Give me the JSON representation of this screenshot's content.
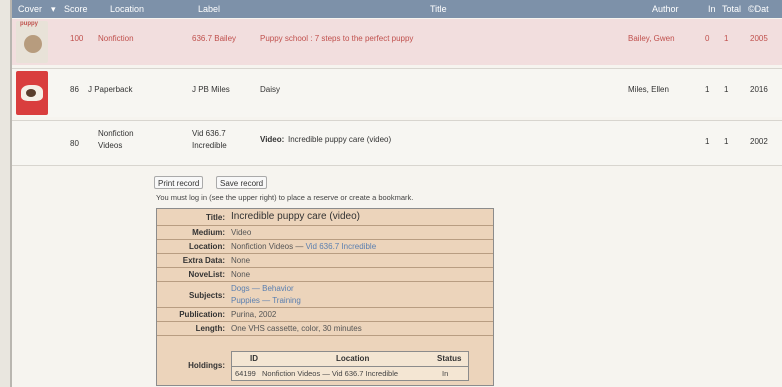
{
  "header": {
    "cover": "Cover",
    "score": "Score",
    "location": "Location",
    "label": "Label",
    "title": "Title",
    "author": "Author",
    "in": "In",
    "total": "Total",
    "date": "©Dat"
  },
  "rows": [
    {
      "cover_text": "puppy",
      "score": "100",
      "location": "Nonfiction",
      "label": "636.7 Bailey",
      "title": "Puppy school : 7 steps to the perfect puppy",
      "author": "Bailey, Gwen",
      "in": "0",
      "total": "1",
      "date": "2005"
    },
    {
      "cover_text": "",
      "score": "86",
      "location": "J Paperback",
      "label": "J PB Miles",
      "title": "Daisy",
      "author": "Miles, Ellen",
      "in": "1",
      "total": "1",
      "date": "2016"
    },
    {
      "cover_text": "",
      "score": "80",
      "location_line1": "Nonfiction",
      "location_line2": "Videos",
      "label_line1": "Vid 636.7",
      "label_line2": "Incredible",
      "title_prefix": "Video:",
      "title": "Incredible puppy care (video)",
      "author": "",
      "in": "1",
      "total": "1",
      "date": "2002"
    }
  ],
  "actions": {
    "print": "Print record",
    "save": "Save record",
    "message": "You must log in (see the upper right) to place a reserve or create a bookmark."
  },
  "detail": {
    "title_label": "Title:",
    "title": "Incredible puppy care (video)",
    "medium_label": "Medium:",
    "medium": "Video",
    "location_label": "Location:",
    "location_text": "Nonfiction Videos —",
    "location_link": "Vid 636.7 Incredible",
    "extra_label": "Extra Data:",
    "extra": "None",
    "novelist_label": "NoveList:",
    "novelist": "None",
    "subjects_label": "Subjects:",
    "subject1": "Dogs — Behavior",
    "subject2": "Puppies — Training",
    "publication_label": "Publication:",
    "publication": "Purina, 2002",
    "length_label": "Length:",
    "length": "One VHS cassette, color, 30 minutes",
    "holdings_label": "Holdings:",
    "holdings": {
      "headers": {
        "id": "ID",
        "location": "Location",
        "status": "Status"
      },
      "row": {
        "id": "64199",
        "location": "Nonfiction Videos — Vid 636.7 Incredible",
        "status": "In"
      }
    }
  },
  "colors": {
    "header": "#7d91a9",
    "highlight_row": "#f2dede",
    "detail_bg": "#ecd4bb"
  }
}
